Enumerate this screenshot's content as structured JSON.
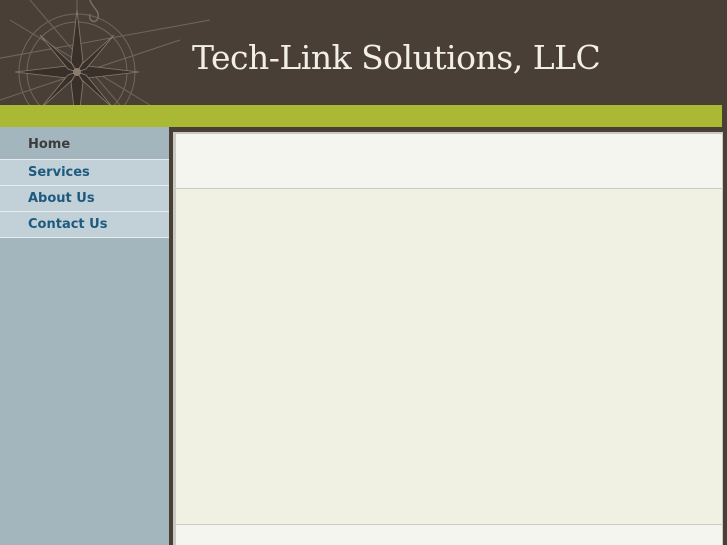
{
  "header": {
    "title": "Tech-Link Solutions, LLC",
    "logo_icon": "compass-rose-icon"
  },
  "nav": {
    "items": [
      {
        "label": "Home",
        "active": true
      },
      {
        "label": "Services",
        "active": false
      },
      {
        "label": "About Us",
        "active": false
      },
      {
        "label": "Contact Us",
        "active": false
      }
    ]
  },
  "colors": {
    "header_bg": "#4a3f37",
    "accent": "#aab933",
    "sidebar_bg": "#a3b5bd",
    "nav_item_bg": "#c2d1d7",
    "nav_link": "#1d5a80",
    "content_bg": "#f0f1e2",
    "title_text": "#f2efe6"
  }
}
